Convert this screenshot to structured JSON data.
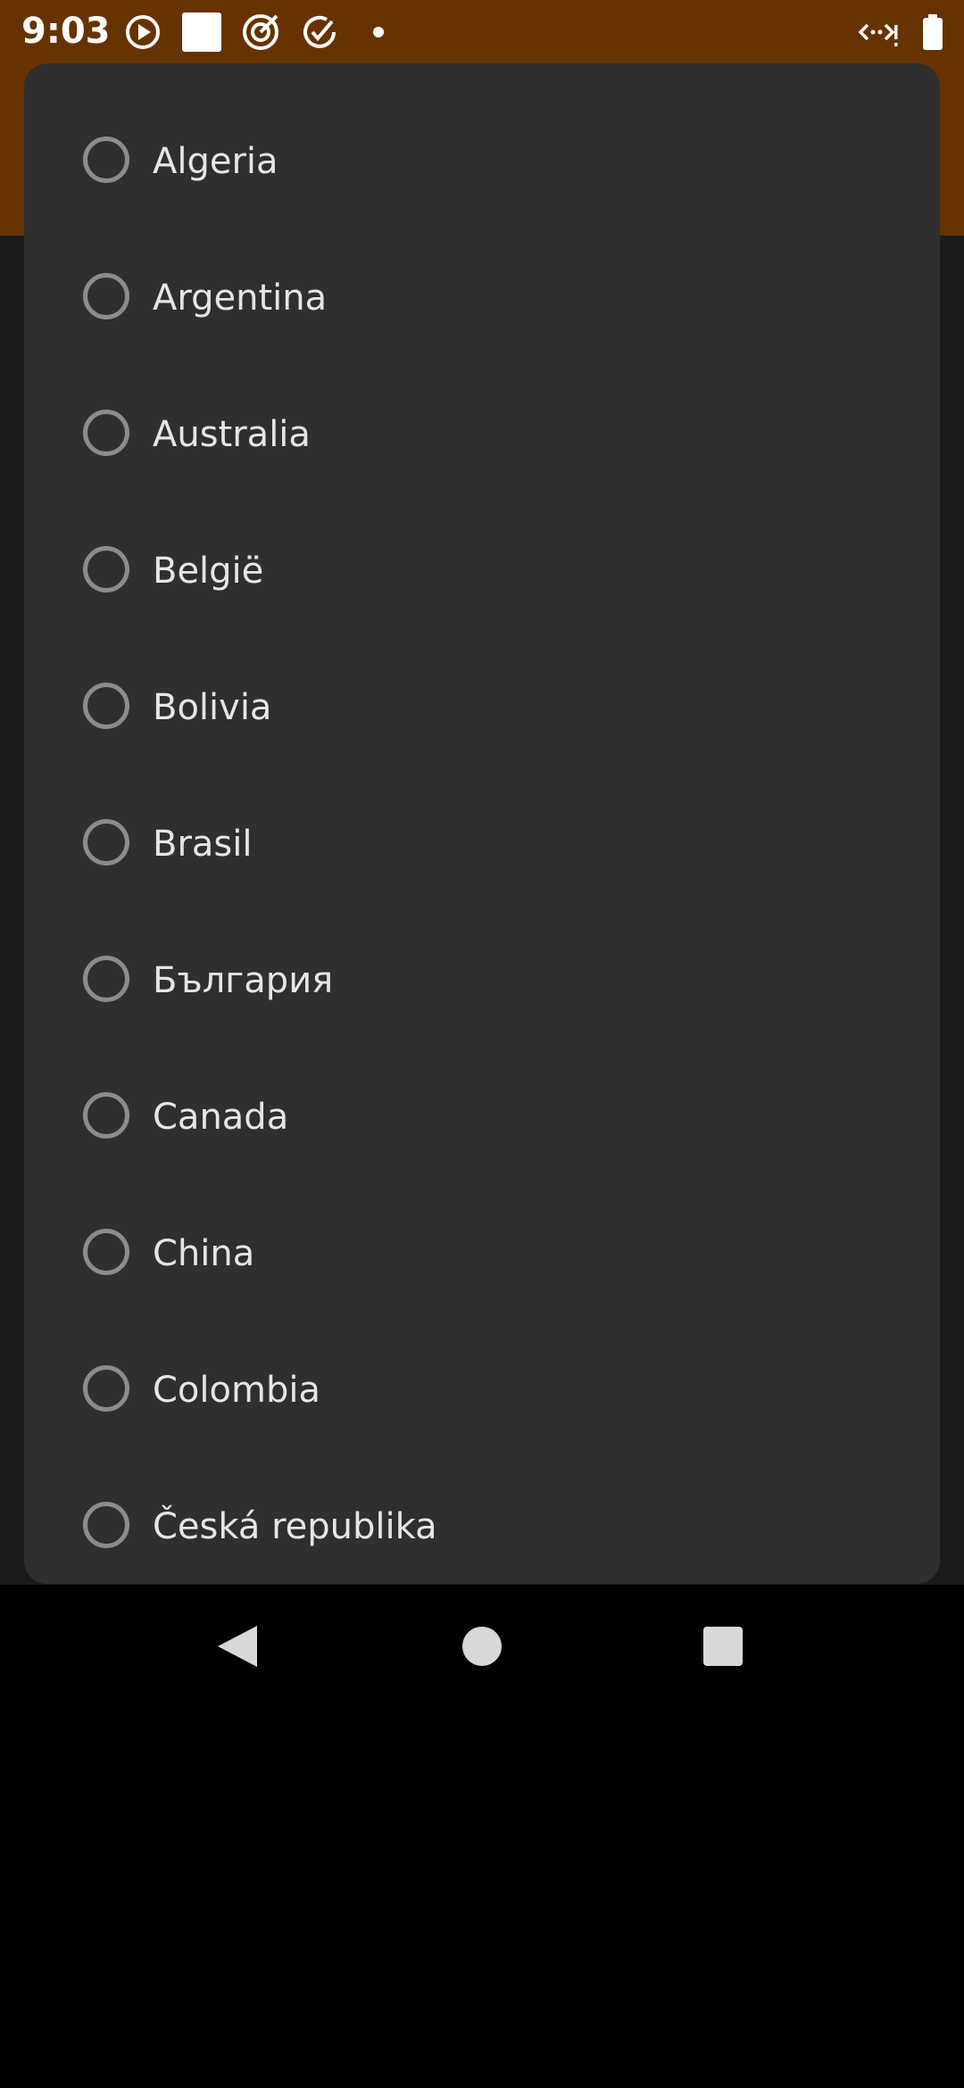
{
  "status_bar": {
    "time": "9:03",
    "icons": [
      "play-circle-icon",
      "white-square-icon",
      "target-icon",
      "check-circle-icon",
      "dot-icon",
      "network-icon",
      "battery-icon"
    ]
  },
  "colors": {
    "status_bar_bg": "#663300",
    "dialog_bg": "#2f2f2f",
    "text": "#e6e6e6",
    "radio_border": "#8c8c8c"
  },
  "dialog": {
    "options": [
      {
        "label": "Algeria",
        "selected": false
      },
      {
        "label": "Argentina",
        "selected": false
      },
      {
        "label": "Australia",
        "selected": false
      },
      {
        "label": "België",
        "selected": false
      },
      {
        "label": "Bolivia",
        "selected": false
      },
      {
        "label": "Brasil",
        "selected": false
      },
      {
        "label": "България",
        "selected": false
      },
      {
        "label": "Canada",
        "selected": false
      },
      {
        "label": "China",
        "selected": false
      },
      {
        "label": "Colombia",
        "selected": false
      },
      {
        "label": "Česká republika",
        "selected": false
      }
    ]
  },
  "nav_bar": {
    "buttons": [
      "back-icon",
      "home-icon",
      "recents-icon"
    ]
  }
}
